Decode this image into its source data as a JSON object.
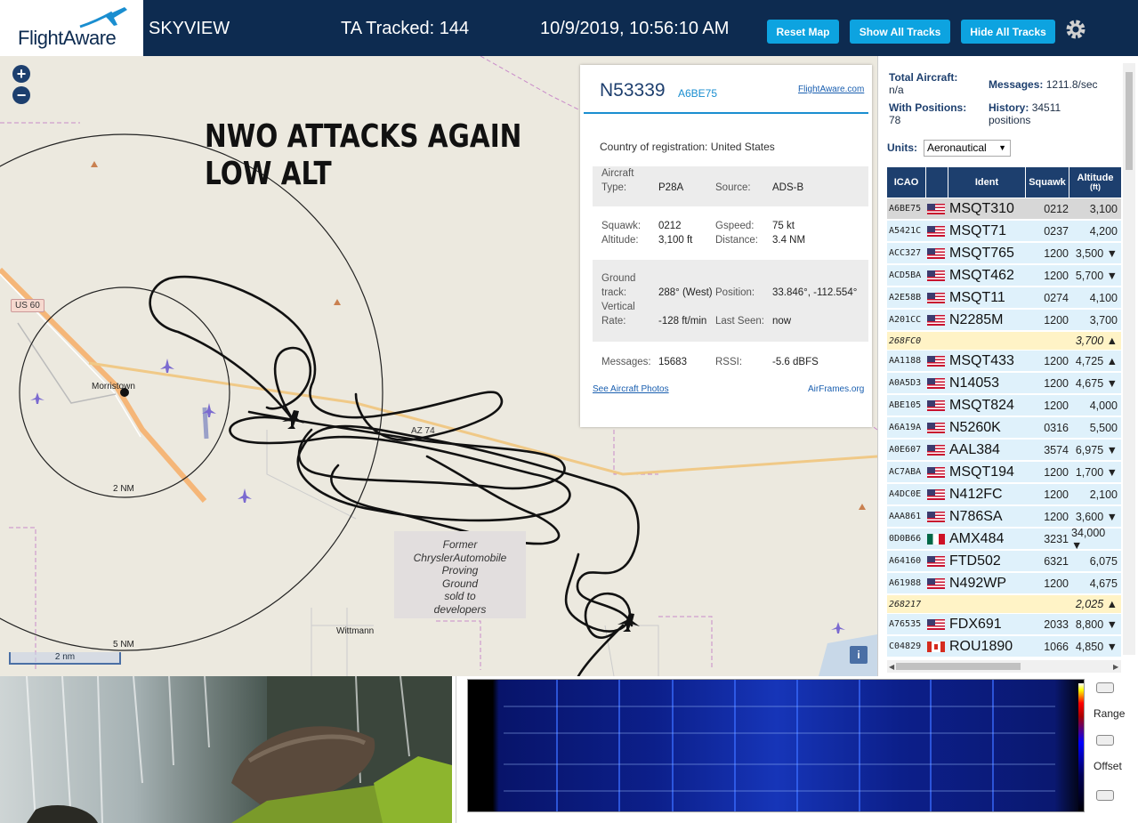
{
  "header": {
    "logo_text": "FlightAware",
    "app_name": "SKYVIEW",
    "tracked": "TA Tracked: 144",
    "datetime": "10/9/2019, 10:56:10 AM",
    "buttons": {
      "reset": "Reset Map",
      "show": "Show All Tracks",
      "hide": "Hide All Tracks"
    },
    "settings_icon": "gear-icon"
  },
  "map": {
    "annotation_line1": "NWO ATTACKS AGAIN",
    "annotation_line2": "LOW ALT",
    "labels": {
      "morristown": "Morristown",
      "wittmann": "Wittmann",
      "range_2nm": "2 NM",
      "range_5nm": "5 NM",
      "us60": "US 60",
      "az74": "AZ 74",
      "former": [
        "Former",
        "ChryslerAutomobile",
        "Proving",
        "Ground",
        "sold to",
        "developers"
      ]
    },
    "scale": "2 nm",
    "zoom_in": "+",
    "zoom_out": "−",
    "info": "i"
  },
  "selected": {
    "callsign": "N53339",
    "hex": "A6BE75",
    "fa_link": "FlightAware.com",
    "country_label": "Country of registration:",
    "country": "United States",
    "aircraft_type_label_1": "Aircraft",
    "aircraft_type_label_2": "Type:",
    "aircraft_type": "P28A",
    "source_label": "Source:",
    "source": "ADS-B",
    "squawk_label": "Squawk:",
    "squawk": "0212",
    "gspeed_label": "Gspeed:",
    "gspeed": "75 kt",
    "altitude_label": "Altitude:",
    "altitude": "3,100 ft",
    "distance_label": "Distance:",
    "distance": "3.4 NM",
    "ground_label_1": "Ground",
    "ground_label_2": "track:",
    "ground_track": "288° (West)",
    "position_label": "Position:",
    "position": "33.846°, -112.554°",
    "vrate_label_1": "Vertical",
    "vrate_label_2": "Rate:",
    "vrate": "-128 ft/min",
    "lastseen_label": "Last Seen:",
    "lastseen": "now",
    "messages_label": "Messages:",
    "messages": "15683",
    "rssi_label": "RSSI:",
    "rssi": "-5.6 dBFS",
    "photos_link": "See Aircraft Photos",
    "airframes_link": "AirFrames.org"
  },
  "sidebar": {
    "total_label": "Total Aircraft:",
    "total_value": "n/a",
    "messages_label": "Messages:",
    "messages_value": "1211.8/sec",
    "withpos_label": "With Positions:",
    "withpos_value": "78",
    "history_label": "History:",
    "history_value": "34511",
    "history_unit": "positions",
    "units_label": "Units:",
    "units_value": "Aeronautical",
    "columns": {
      "icao": "ICAO",
      "ident": "Ident",
      "squawk": "Squawk",
      "alt1": "Altitude",
      "alt2": "(ft)"
    },
    "rows": [
      {
        "icao": "A6BE75",
        "flag": "US",
        "ident": "MSQT310",
        "squawk": "0212",
        "alt": "3,100",
        "type": "sel"
      },
      {
        "icao": "A5421C",
        "flag": "US",
        "ident": "MSQT71",
        "squawk": "0237",
        "alt": "4,200",
        "type": ""
      },
      {
        "icao": "ACC327",
        "flag": "US",
        "ident": "MSQT765",
        "squawk": "1200",
        "alt": "3,500 ▼",
        "type": ""
      },
      {
        "icao": "ACD5BA",
        "flag": "US",
        "ident": "MSQT462",
        "squawk": "1200",
        "alt": "5,700 ▼",
        "type": ""
      },
      {
        "icao": "A2E58B",
        "flag": "US",
        "ident": "MSQT11",
        "squawk": "0274",
        "alt": "4,100",
        "type": ""
      },
      {
        "icao": "A201CC",
        "flag": "US",
        "ident": "N2285M",
        "squawk": "1200",
        "alt": "3,700",
        "type": ""
      },
      {
        "icao": "268FC0",
        "flag": "",
        "ident": "",
        "squawk": "",
        "alt": "3,700 ▲",
        "type": "nopos"
      },
      {
        "icao": "AA1188",
        "flag": "US",
        "ident": "MSQT433",
        "squawk": "1200",
        "alt": "4,725 ▲",
        "type": ""
      },
      {
        "icao": "A0A5D3",
        "flag": "US",
        "ident": "N14053",
        "squawk": "1200",
        "alt": "4,675 ▼",
        "type": ""
      },
      {
        "icao": "ABE105",
        "flag": "US",
        "ident": "MSQT824",
        "squawk": "1200",
        "alt": "4,000",
        "type": ""
      },
      {
        "icao": "A6A19A",
        "flag": "US",
        "ident": "N5260K",
        "squawk": "0316",
        "alt": "5,500",
        "type": ""
      },
      {
        "icao": "A0E607",
        "flag": "US",
        "ident": "AAL384",
        "squawk": "3574",
        "alt": "6,975 ▼",
        "type": ""
      },
      {
        "icao": "AC7ABA",
        "flag": "US",
        "ident": "MSQT194",
        "squawk": "1200",
        "alt": "1,700 ▼",
        "type": ""
      },
      {
        "icao": "A4DC0E",
        "flag": "US",
        "ident": "N412FC",
        "squawk": "1200",
        "alt": "2,100",
        "type": ""
      },
      {
        "icao": "AAA861",
        "flag": "US",
        "ident": "N786SA",
        "squawk": "1200",
        "alt": "3,600 ▼",
        "type": ""
      },
      {
        "icao": "0D0B66",
        "flag": "MX",
        "ident": "AMX484",
        "squawk": "3231",
        "alt": "34,000 ▼",
        "type": ""
      },
      {
        "icao": "A64160",
        "flag": "US",
        "ident": "FTD502",
        "squawk": "6321",
        "alt": "6,075",
        "type": ""
      },
      {
        "icao": "A61988",
        "flag": "US",
        "ident": "N492WP",
        "squawk": "1200",
        "alt": "4,675",
        "type": ""
      },
      {
        "icao": "268217",
        "flag": "",
        "ident": "",
        "squawk": "",
        "alt": "2,025 ▲",
        "type": "nopos"
      },
      {
        "icao": "A76535",
        "flag": "US",
        "ident": "FDX691",
        "squawk": "2033",
        "alt": "8,800 ▼",
        "type": ""
      },
      {
        "icao": "C04829",
        "flag": "CA",
        "ident": "ROU1890",
        "squawk": "1066",
        "alt": "4,850 ▼",
        "type": ""
      }
    ]
  },
  "spectrum": {
    "range_label": "Range",
    "offset_label": "Offset"
  },
  "colors": {
    "header_bg": "#0d2b50",
    "button": "#0da3e0",
    "row_bg": "#dff1fb",
    "nopos_bg": "#fff3c6",
    "track": "#111111"
  }
}
